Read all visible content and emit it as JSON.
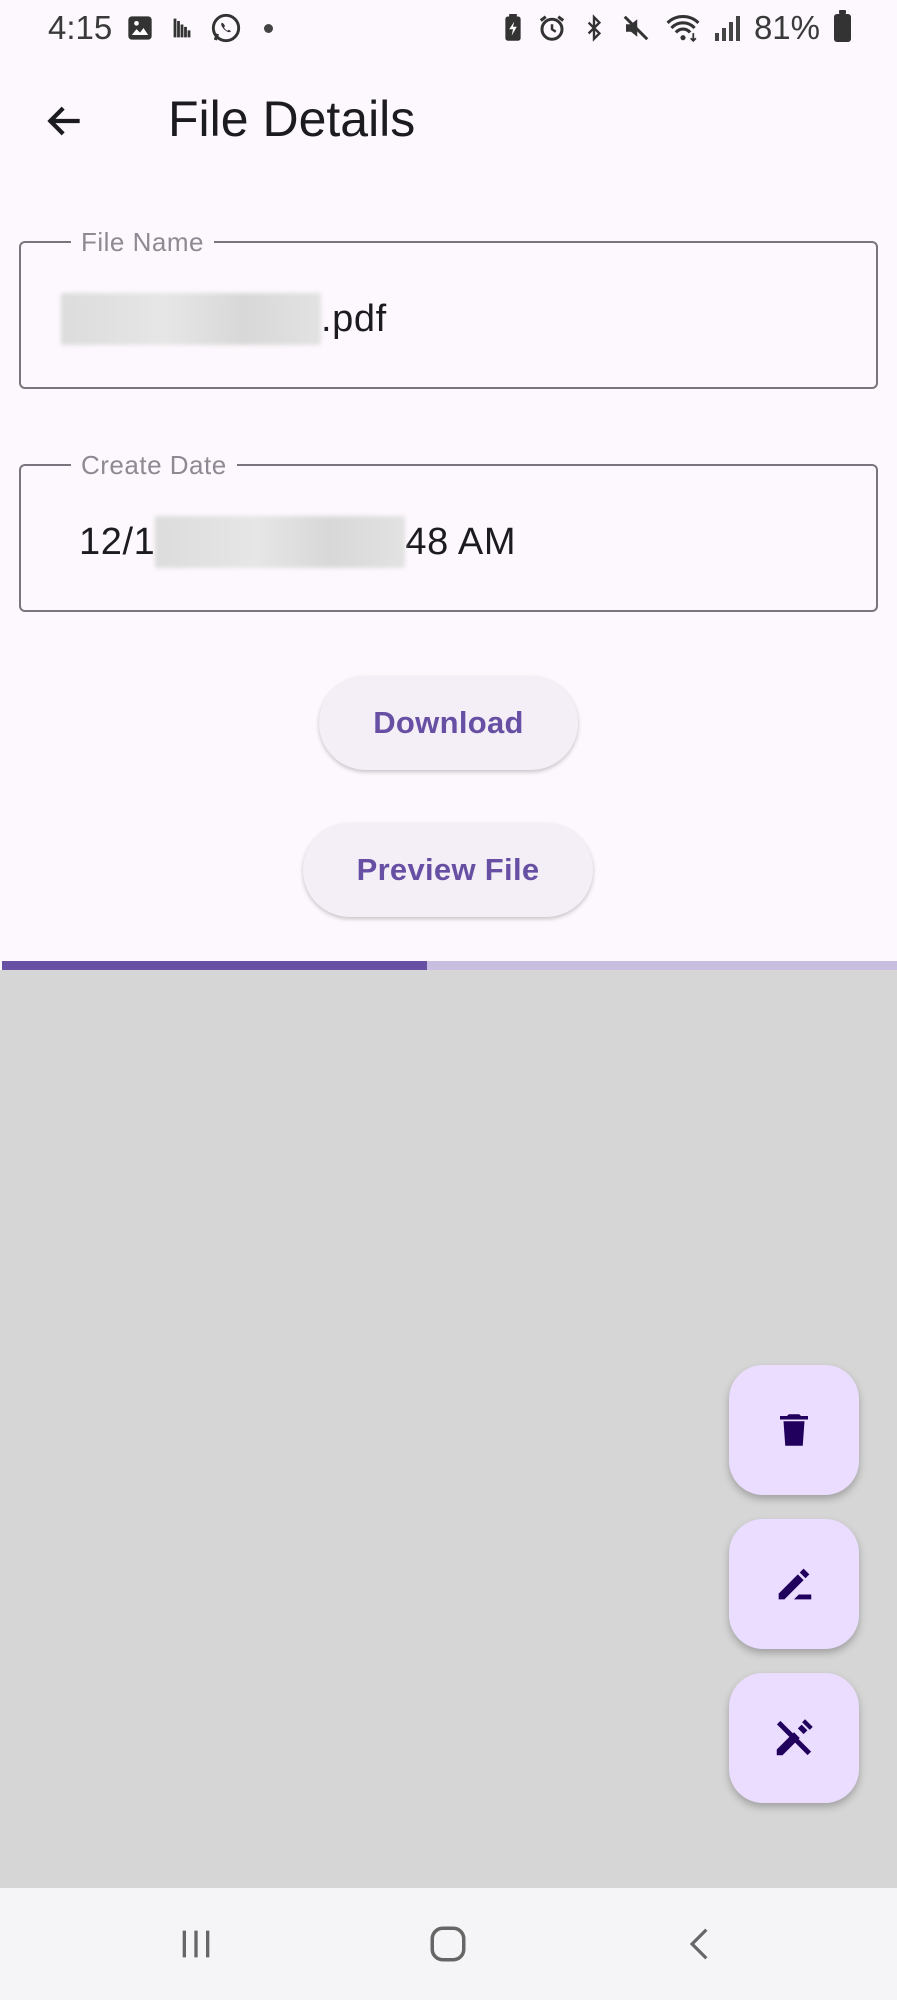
{
  "status_bar": {
    "time": "4:15",
    "battery": "81%",
    "left_icons": [
      "gallery-icon",
      "weather-icon",
      "whatsapp-icon",
      "notification-dot"
    ],
    "right_icons": [
      "battery-saver-icon",
      "alarm-icon",
      "bluetooth-icon",
      "mute-icon",
      "wifi-icon",
      "signal-icon",
      "battery-icon"
    ]
  },
  "app_bar": {
    "title": "File Details",
    "back_icon": "arrow-back-icon"
  },
  "file_name_field": {
    "label": "File Name",
    "value_suffix": ".pdf"
  },
  "create_date_field": {
    "label": "Create Date",
    "value_prefix": "12/1",
    "value_suffix": "48 AM"
  },
  "buttons": {
    "download": "Download",
    "preview": "Preview File"
  },
  "progress": {
    "fraction": 0.475
  },
  "fabs": [
    "delete-icon",
    "edit-icon",
    "edit-off-icon"
  ],
  "nav_bar": [
    "recent-apps-icon",
    "home-icon",
    "back-icon"
  ],
  "colors": {
    "accent": "#6750a4",
    "fab_bg": "#eaddff",
    "fab_icon": "#21005d",
    "background": "#fdf8fd",
    "preview_bg": "#d6d6d6"
  }
}
